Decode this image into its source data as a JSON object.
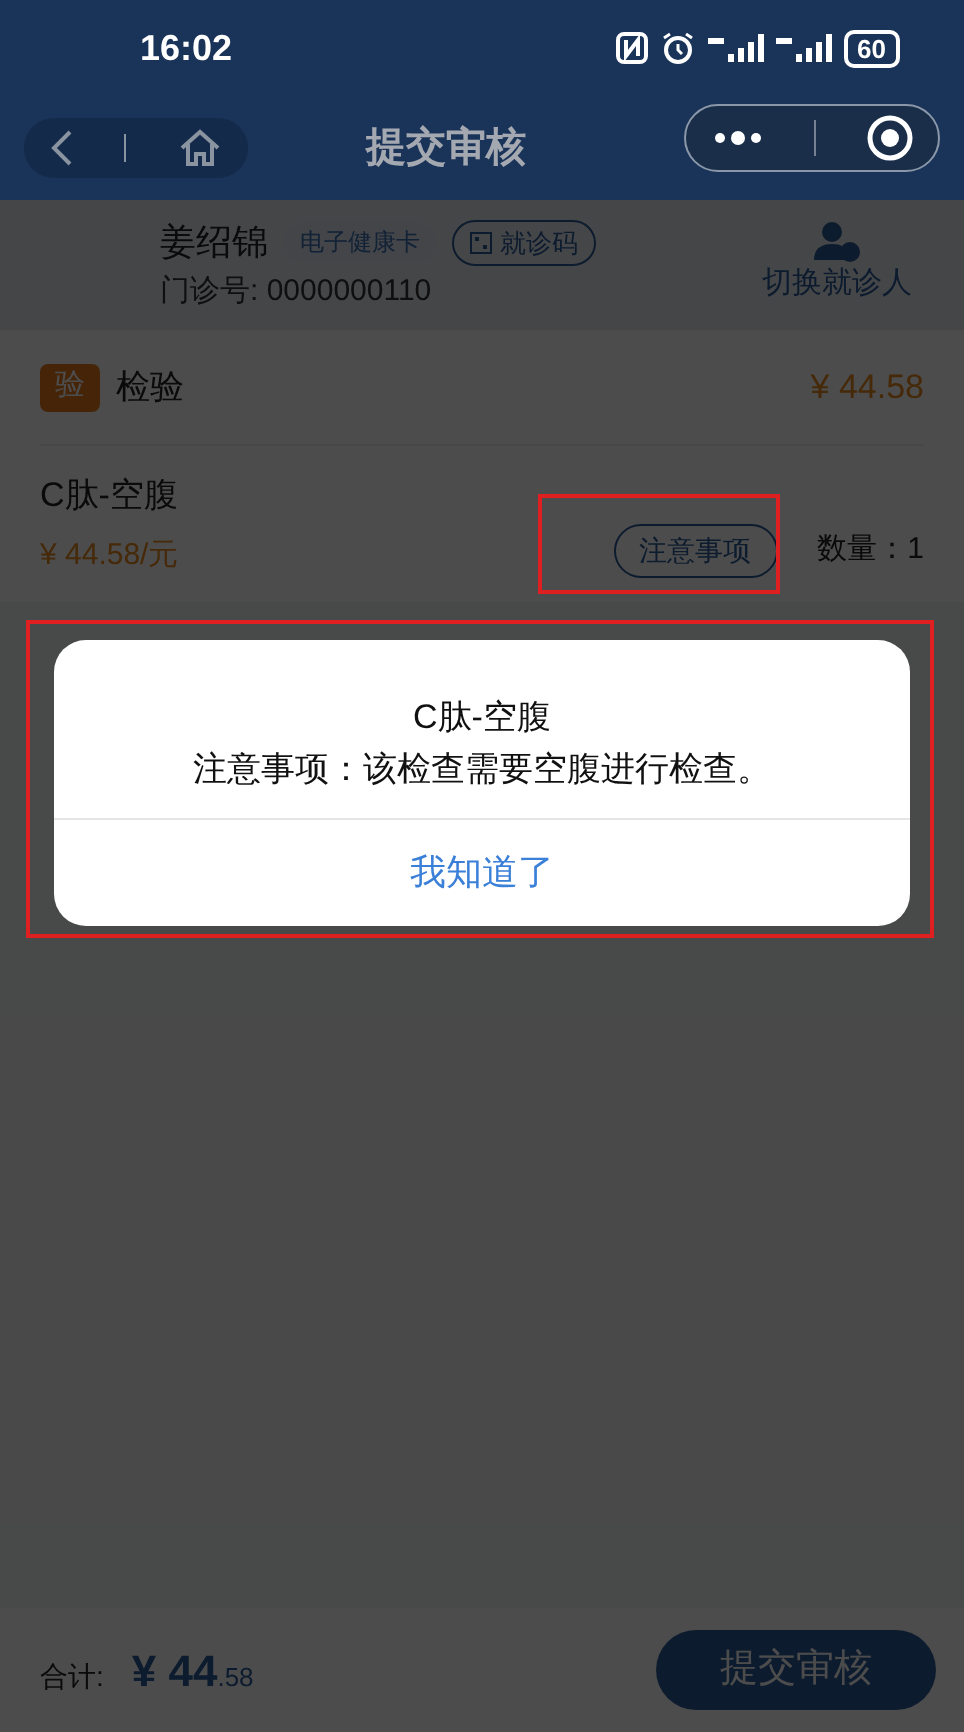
{
  "status_bar": {
    "time": "16:02",
    "battery": "60"
  },
  "nav": {
    "title": "提交审核"
  },
  "patient": {
    "name": "姜绍锦",
    "health_card_tag": "电子健康卡",
    "visit_code_button": "就诊码",
    "outpatient_no": "门诊号: 0000000110",
    "switch_label": "切换就诊人"
  },
  "section": {
    "badge": "验",
    "title": "检验",
    "total": "¥ 44.58"
  },
  "items": [
    {
      "name": "C肽-空腹",
      "price": "¥ 44.58/元",
      "notice_button": "注意事项",
      "quantity": "数量：1"
    }
  ],
  "dialog": {
    "title": "C肽-空腹",
    "message": "注意事项：该检查需要空腹进行检查。",
    "button": "我知道了"
  },
  "footer": {
    "label": "合计:",
    "amount": "¥ 44",
    "amount_decimal": ".58",
    "submit": "提交审核"
  }
}
